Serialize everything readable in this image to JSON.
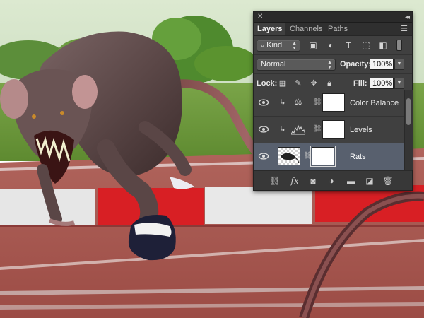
{
  "panel": {
    "tabs": [
      {
        "label": "Layers",
        "active": true
      },
      {
        "label": "Channels",
        "active": false
      },
      {
        "label": "Paths",
        "active": false
      }
    ],
    "filter": {
      "kind_label": "Kind",
      "icons": [
        "image-filter-icon",
        "adjustment-filter-icon",
        "type-filter-icon",
        "shape-filter-icon",
        "smart-object-filter-icon",
        "filter-toggle-icon"
      ]
    },
    "blend": {
      "mode": "Normal",
      "opacity_label": "Opacity:",
      "opacity_value": "100%"
    },
    "lock": {
      "label": "Lock:",
      "icons": [
        "lock-transparent-icon",
        "lock-image-icon",
        "lock-position-icon",
        "lock-all-icon"
      ],
      "fill_label": "Fill:",
      "fill_value": "100%"
    },
    "layers": [
      {
        "name": "Color Balance",
        "type": "adjustment",
        "icon": "balance-scale-icon",
        "clipped": true,
        "selected": false
      },
      {
        "name": "Levels",
        "type": "adjustment",
        "icon": "histogram-icon",
        "clipped": true,
        "selected": false
      },
      {
        "name": "Rats",
        "type": "pixel",
        "icon": "layer-thumbnail",
        "clipped": false,
        "selected": true
      }
    ],
    "bottom_icons": [
      "link-layers-icon",
      "fx-icon",
      "add-mask-icon",
      "new-adjustment-icon",
      "new-group-icon",
      "new-layer-icon",
      "trash-icon"
    ]
  },
  "colors": {
    "panel_bg": "#404040",
    "selected_layer": "#58606e",
    "track": "#a0524c",
    "hurdle_red": "#d81f24",
    "grass": "#6f9a3c"
  }
}
